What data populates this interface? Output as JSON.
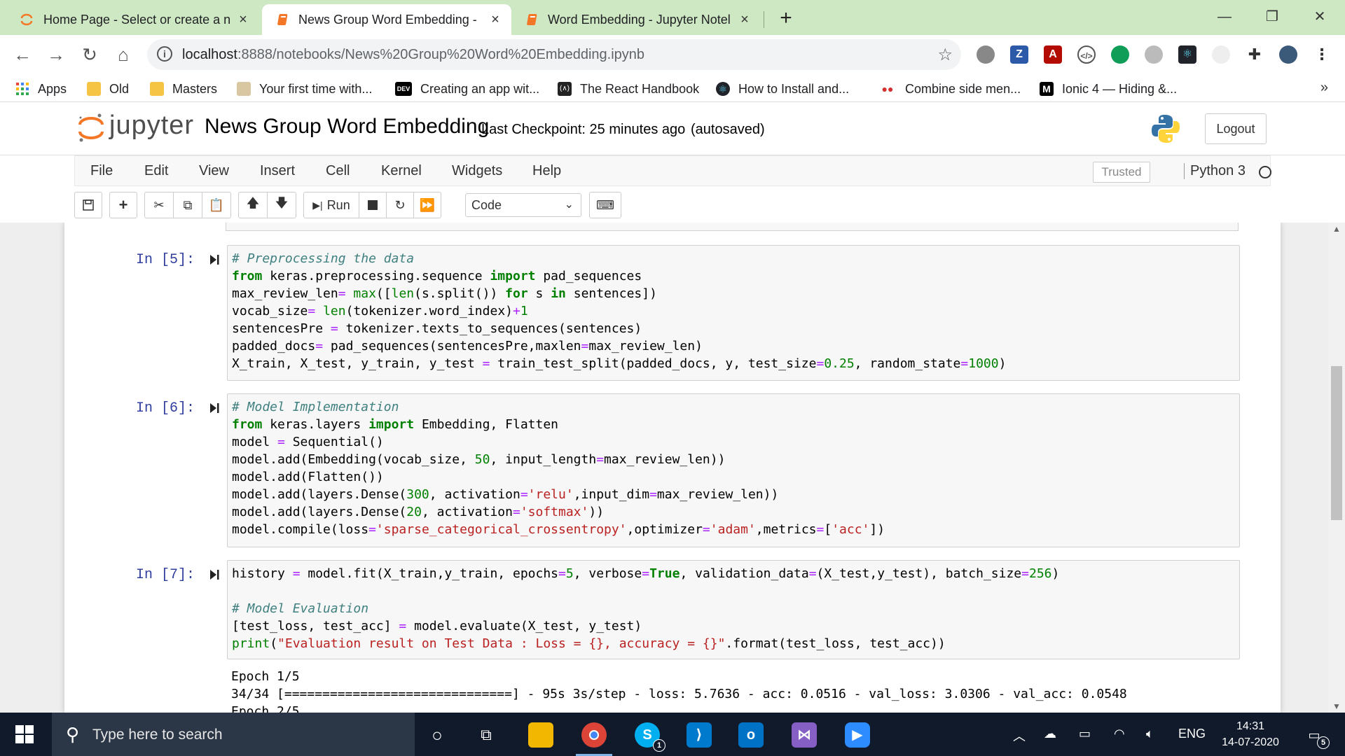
{
  "browser": {
    "tabs": [
      {
        "title": "Home Page - Select or create a n",
        "active": false
      },
      {
        "title": "News Group Word Embedding -",
        "active": true
      },
      {
        "title": "Word Embedding - Jupyter Notel",
        "active": false
      }
    ],
    "url_host": "localhost",
    "url_path": ":8888/notebooks/News%20Group%20Word%20Embedding.ipynb",
    "bookmarks": [
      {
        "label": "Apps",
        "icon": "apps-grid-icon"
      },
      {
        "label": "Old",
        "icon": "folder-icon"
      },
      {
        "label": "Masters",
        "icon": "folder-icon"
      },
      {
        "label": "Your first time with...",
        "icon": "page-icon"
      },
      {
        "label": "Creating an app wit...",
        "icon": "dev-icon"
      },
      {
        "label": "The React Handbook",
        "icon": "react-handbook-icon"
      },
      {
        "label": "How to Install and...",
        "icon": "react-icon"
      },
      {
        "label": "Combine side men...",
        "icon": "dots-icon"
      },
      {
        "label": "Ionic 4 — Hiding &...",
        "icon": "medium-icon"
      }
    ],
    "bookmarks_more": "»"
  },
  "jupyter": {
    "logo_text": "jupyter",
    "notebook_title": "News Group Word Embedding",
    "checkpoint": "Last Checkpoint: 25 minutes ago",
    "autosave": "(autosaved)",
    "logout": "Logout",
    "menu": [
      "File",
      "Edit",
      "View",
      "Insert",
      "Cell",
      "Kernel",
      "Widgets",
      "Help"
    ],
    "trusted": "Trusted",
    "kernel": "Python 3",
    "run_label": "Run",
    "cell_type": "Code"
  },
  "cells": [
    {
      "prompt": "In [5]:",
      "lines": [
        [
          [
            "c",
            "# Preprocessing the data"
          ]
        ],
        [
          [
            "k",
            "from"
          ],
          [
            "v",
            " keras.preprocessing.sequence "
          ],
          [
            "k",
            "import"
          ],
          [
            "v",
            " pad_sequences"
          ]
        ],
        [
          [
            "v",
            "max_review_len"
          ],
          [
            "o",
            "="
          ],
          [
            "v",
            " "
          ],
          [
            "b",
            "max"
          ],
          [
            "v",
            "(["
          ],
          [
            "b",
            "len"
          ],
          [
            "v",
            "(s.split()) "
          ],
          [
            "k",
            "for"
          ],
          [
            "v",
            " s "
          ],
          [
            "k",
            "in"
          ],
          [
            "v",
            " sentences])"
          ]
        ],
        [
          [
            "v",
            "vocab_size"
          ],
          [
            "o",
            "="
          ],
          [
            "v",
            " "
          ],
          [
            "b",
            "len"
          ],
          [
            "v",
            "(tokenizer.word_index)"
          ],
          [
            "o",
            "+"
          ],
          [
            "n",
            "1"
          ]
        ],
        [
          [
            "v",
            "sentencesPre "
          ],
          [
            "o",
            "="
          ],
          [
            "v",
            " tokenizer.texts_to_sequences(sentences)"
          ]
        ],
        [
          [
            "v",
            "padded_docs"
          ],
          [
            "o",
            "="
          ],
          [
            "v",
            " pad_sequences(sentencesPre,maxlen"
          ],
          [
            "o",
            "="
          ],
          [
            "v",
            "max_review_len)"
          ]
        ],
        [
          [
            "v",
            "X_train, X_test, y_train, y_test "
          ],
          [
            "o",
            "="
          ],
          [
            "v",
            " train_test_split(padded_docs, y, test_size"
          ],
          [
            "o",
            "="
          ],
          [
            "n",
            "0.25"
          ],
          [
            "v",
            ", random_state"
          ],
          [
            "o",
            "="
          ],
          [
            "n",
            "1000"
          ],
          [
            "v",
            ")"
          ]
        ]
      ]
    },
    {
      "prompt": "In [6]:",
      "lines": [
        [
          [
            "c",
            "# Model Implementation"
          ]
        ],
        [
          [
            "k",
            "from"
          ],
          [
            "v",
            " keras.layers "
          ],
          [
            "k",
            "import"
          ],
          [
            "v",
            " Embedding, Flatten"
          ]
        ],
        [
          [
            "v",
            "model "
          ],
          [
            "o",
            "="
          ],
          [
            "v",
            " Sequential()"
          ]
        ],
        [
          [
            "v",
            "model.add(Embedding(vocab_size, "
          ],
          [
            "n",
            "50"
          ],
          [
            "v",
            ", input_length"
          ],
          [
            "o",
            "="
          ],
          [
            "v",
            "max_review_len))"
          ]
        ],
        [
          [
            "v",
            "model.add(Flatten())"
          ]
        ],
        [
          [
            "v",
            "model.add(layers.Dense("
          ],
          [
            "n",
            "300"
          ],
          [
            "v",
            ", activation"
          ],
          [
            "o",
            "="
          ],
          [
            "s",
            "'relu'"
          ],
          [
            "v",
            ",input_dim"
          ],
          [
            "o",
            "="
          ],
          [
            "v",
            "max_review_len))"
          ]
        ],
        [
          [
            "v",
            "model.add(layers.Dense("
          ],
          [
            "n",
            "20"
          ],
          [
            "v",
            ", activation"
          ],
          [
            "o",
            "="
          ],
          [
            "s",
            "'softmax'"
          ],
          [
            "v",
            "))"
          ]
        ],
        [
          [
            "v",
            "model.compile(loss"
          ],
          [
            "o",
            "="
          ],
          [
            "s",
            "'sparse_categorical_crossentropy'"
          ],
          [
            "v",
            ",optimizer"
          ],
          [
            "o",
            "="
          ],
          [
            "s",
            "'adam'"
          ],
          [
            "v",
            ",metrics"
          ],
          [
            "o",
            "="
          ],
          [
            "v",
            "["
          ],
          [
            "s",
            "'acc'"
          ],
          [
            "v",
            "])"
          ]
        ]
      ]
    },
    {
      "prompt": "In [7]:",
      "lines": [
        [
          [
            "v",
            "history "
          ],
          [
            "o",
            "="
          ],
          [
            "v",
            " model.fit(X_train,y_train, epochs"
          ],
          [
            "o",
            "="
          ],
          [
            "n",
            "5"
          ],
          [
            "v",
            ", verbose"
          ],
          [
            "o",
            "="
          ],
          [
            "k",
            "True"
          ],
          [
            "v",
            ", validation_data"
          ],
          [
            "o",
            "="
          ],
          [
            "v",
            "(X_test,y_test), batch_size"
          ],
          [
            "o",
            "="
          ],
          [
            "n",
            "256"
          ],
          [
            "v",
            ")"
          ]
        ],
        [],
        [
          [
            "c",
            "# Model Evaluation"
          ]
        ],
        [
          [
            "v",
            "[test_loss, test_acc] "
          ],
          [
            "o",
            "="
          ],
          [
            "v",
            " model.evaluate(X_test, y_test)"
          ]
        ],
        [
          [
            "b",
            "print"
          ],
          [
            "v",
            "("
          ],
          [
            "s",
            "\"Evaluation result on Test Data : Loss = {}, accuracy = {}\""
          ],
          [
            "v",
            ".format(test_loss, test_acc))"
          ]
        ]
      ],
      "output": [
        "Epoch 1/5",
        "34/34 [==============================] - 95s 3s/step - loss: 5.7636 - acc: 0.0516 - val_loss: 3.0306 - val_acc: 0.0548",
        "Epoch 2/5"
      ]
    }
  ],
  "taskbar": {
    "search_placeholder": "Type here to search",
    "language": "ENG",
    "time": "14:31",
    "date": "14-07-2020",
    "notification_count": "5",
    "skype_badge": "1"
  },
  "colors": {
    "tabbar": "#cfe8c4",
    "jupyter_orange": "#f37726",
    "prompt_blue": "#303f9f",
    "taskbar": "#101a2b"
  }
}
